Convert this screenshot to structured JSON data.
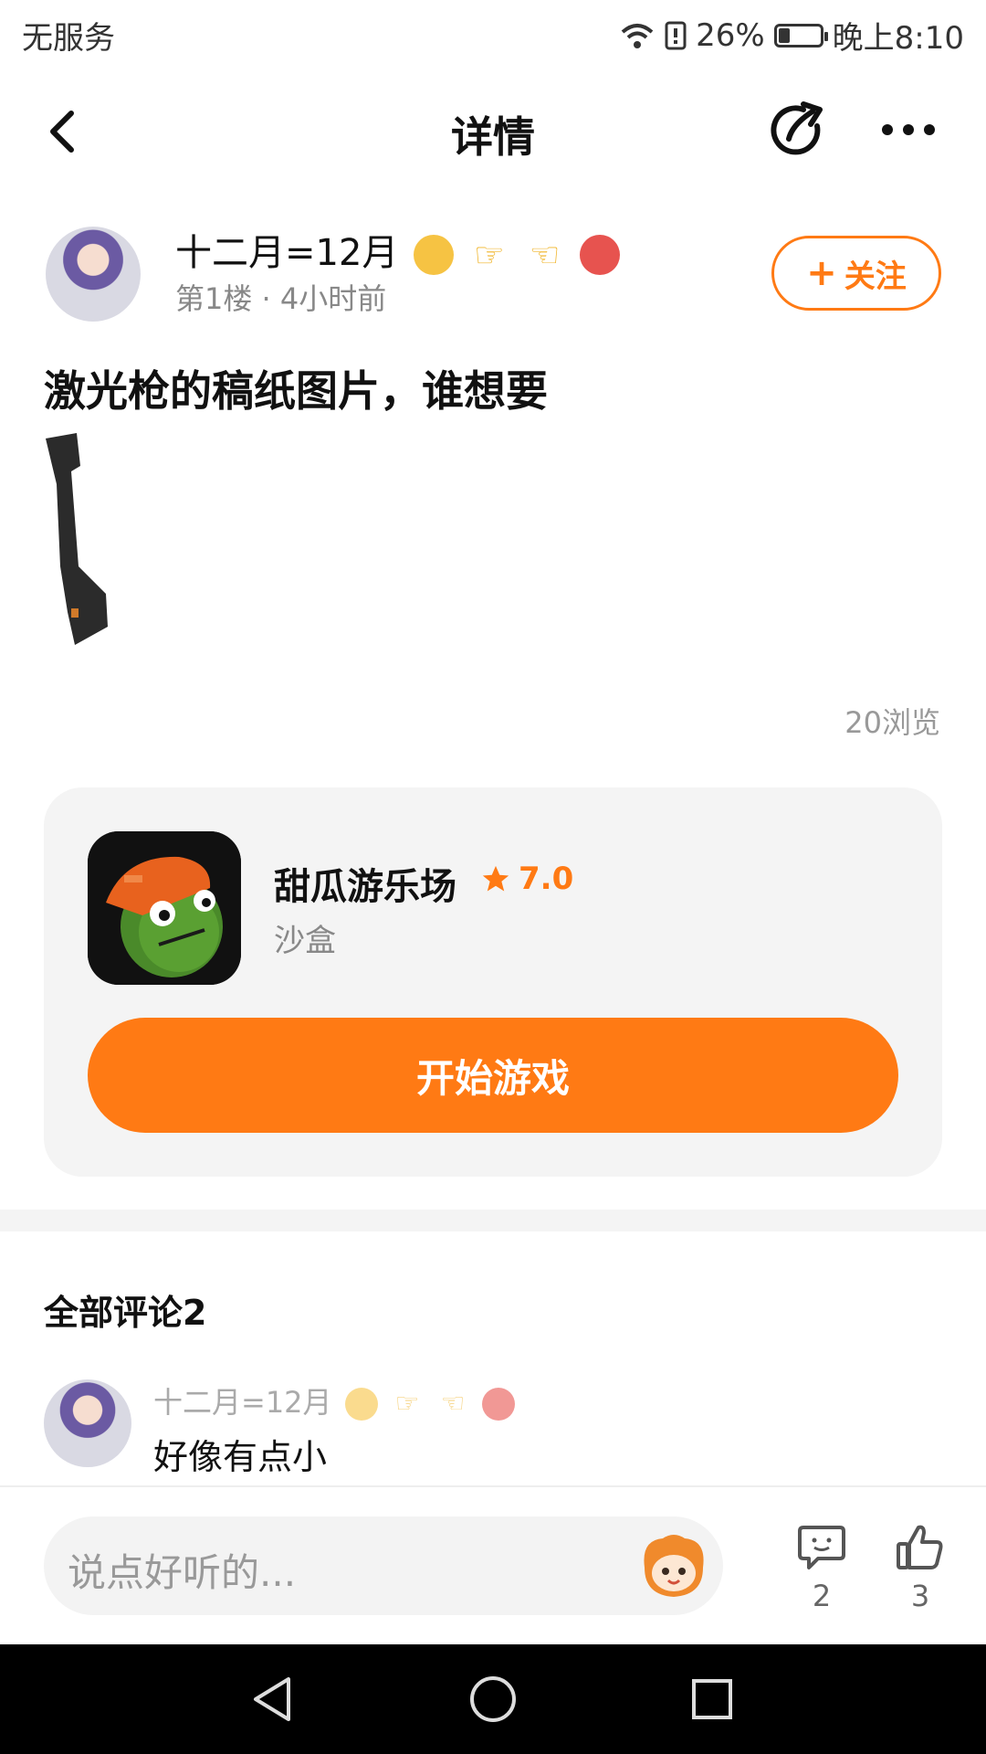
{
  "status_bar": {
    "carrier": "无服务",
    "battery": "26%",
    "battery_level": 0.26,
    "time": "晚上8:10",
    "icons": [
      "wifi-icon",
      "sim-alert-icon",
      "battery-icon"
    ]
  },
  "header": {
    "title": "详情",
    "icons": [
      "back-arrow-icon",
      "share-icon",
      "more-dots-icon"
    ]
  },
  "post": {
    "author": "十二月=12月",
    "floor_time": "第1楼 · 4小时前",
    "follow_plus": "+",
    "follow_label": "关注",
    "title": "激光枪的稿纸图片，谁想要",
    "views": "20浏览"
  },
  "game": {
    "name": "甜瓜游乐场",
    "rating": "7.0",
    "category": "沙盒",
    "play_label": "开始游戏"
  },
  "comments": {
    "title": "全部评论2",
    "items": [
      {
        "author": "十二月=12月",
        "text": "好像有点小"
      }
    ]
  },
  "bottom_bar": {
    "placeholder": "说点好听的...",
    "comment_count": "2",
    "like_count": "3"
  },
  "colors": {
    "accent": "#ff7a14",
    "card_bg": "#f4f4f4",
    "text": "#111111",
    "muted": "#888888"
  }
}
